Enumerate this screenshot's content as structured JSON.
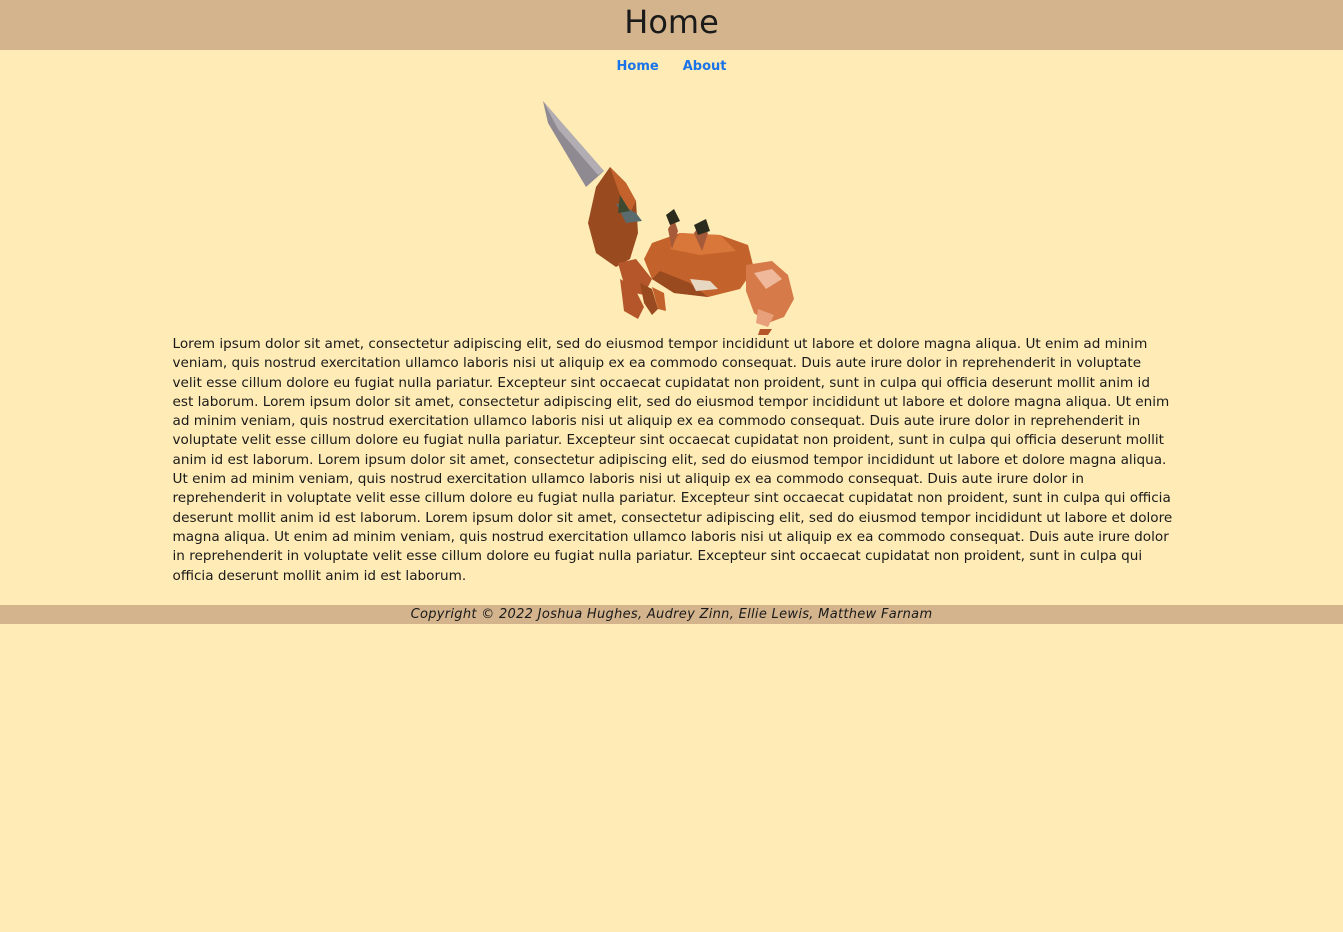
{
  "header": {
    "title": "Home"
  },
  "nav": {
    "items": [
      {
        "label": "Home"
      },
      {
        "label": "About"
      }
    ]
  },
  "hero": {
    "image_icon": "crab-with-sword-icon"
  },
  "main": {
    "paragraph": "Lorem ipsum dolor sit amet, consectetur adipiscing elit, sed do eiusmod tempor incididunt ut labore et dolore magna aliqua. Ut enim ad minim veniam, quis nostrud exercitation ullamco laboris nisi ut aliquip ex ea commodo consequat. Duis aute irure dolor in reprehenderit in voluptate velit esse cillum dolore eu fugiat nulla pariatur. Excepteur sint occaecat cupidatat non proident, sunt in culpa qui officia deserunt mollit anim id est laborum. Lorem ipsum dolor sit amet, consectetur adipiscing elit, sed do eiusmod tempor incididunt ut labore et dolore magna aliqua. Ut enim ad minim veniam, quis nostrud exercitation ullamco laboris nisi ut aliquip ex ea commodo consequat. Duis aute irure dolor in reprehenderit in voluptate velit esse cillum dolore eu fugiat nulla pariatur. Excepteur sint occaecat cupidatat non proident, sunt in culpa qui officia deserunt mollit anim id est laborum. Lorem ipsum dolor sit amet, consectetur adipiscing elit, sed do eiusmod tempor incididunt ut labore et dolore magna aliqua. Ut enim ad minim veniam, quis nostrud exercitation ullamco laboris nisi ut aliquip ex ea commodo consequat. Duis aute irure dolor in reprehenderit in voluptate velit esse cillum dolore eu fugiat nulla pariatur. Excepteur sint occaecat cupidatat non proident, sunt in culpa qui officia deserunt mollit anim id est laborum. Lorem ipsum dolor sit amet, consectetur adipiscing elit, sed do eiusmod tempor incididunt ut labore et dolore magna aliqua. Ut enim ad minim veniam, quis nostrud exercitation ullamco laboris nisi ut aliquip ex ea commodo consequat. Duis aute irure dolor in reprehenderit in voluptate velit esse cillum dolore eu fugiat nulla pariatur. Excepteur sint occaecat cupidatat non proident, sunt in culpa qui officia deserunt mollit anim id est laborum."
  },
  "footer": {
    "copyright": "Copyright © 2022 Joshua Hughes, Audrey Zinn, Ellie Lewis, Matthew Farnam"
  },
  "colors": {
    "background": "#feebb5",
    "header_footer": "#d3b48c",
    "link": "#1a73e8"
  }
}
